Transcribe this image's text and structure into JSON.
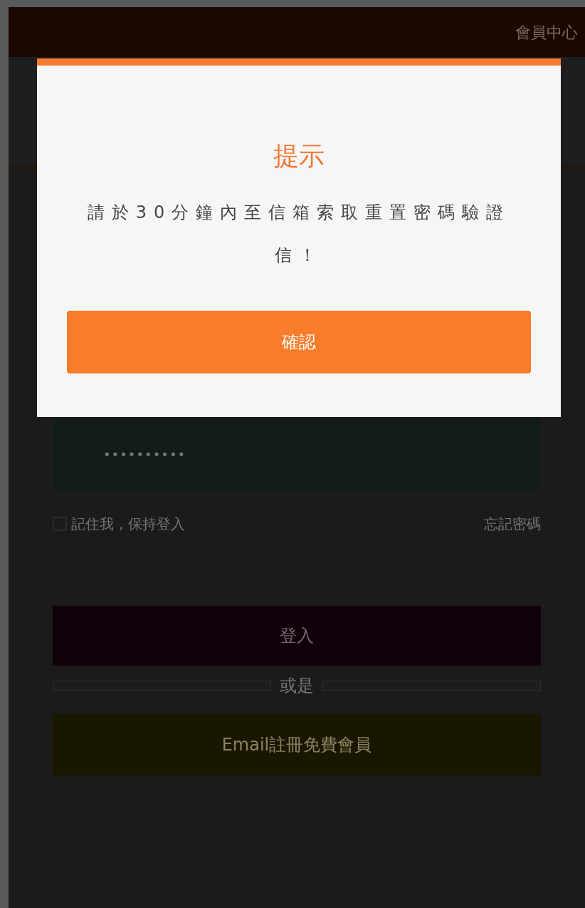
{
  "header": {
    "title": "會員中心"
  },
  "form": {
    "password": {
      "value": "••••••••••"
    },
    "remember": {
      "label": "記住我，保持登入",
      "checked": false
    },
    "forgot_link": "忘記密碼",
    "login_button": "登入",
    "divider": "或是",
    "register_button": "Email註冊免費會員"
  },
  "dialog": {
    "title": "提示",
    "message": "請於30分鐘內至信箱索取重置密碼驗證信！",
    "confirm_button": "確認"
  }
}
